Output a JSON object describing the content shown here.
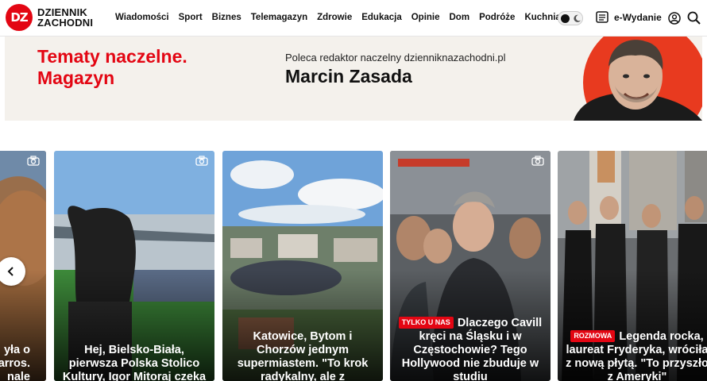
{
  "header": {
    "logo_badge": "DZ",
    "logo_line1": "DZIENNIK",
    "logo_line2": "ZACHODNI",
    "nav": [
      "Wiadomości",
      "Sport",
      "Biznes",
      "Telemagazyn",
      "Zdrowie",
      "Edukacja",
      "Opinie",
      "Dom",
      "Podróże",
      "Kuchnia"
    ],
    "ewydanie_label": "e-Wydanie",
    "icons": [
      "theme-toggle",
      "newspaper-icon",
      "user-icon",
      "search-icon"
    ]
  },
  "banner": {
    "title_line1": "Tematy naczelne.",
    "title_line2": "Magazyn",
    "kicker": "Poleca redaktor naczelny dzienniknazachodni.pl",
    "name": "Marcin Zasada"
  },
  "carousel": {
    "cards": [
      {
        "caption": "yła o\narros.\nnale",
        "badge": ""
      },
      {
        "caption": "Hej, Bielsko-Biała, pierwsza Polska Stolico Kultury, Igor Mitoraj czeka na twój gest!",
        "badge": ""
      },
      {
        "caption": "Katowice, Bytom i Chorzów jednym supermiastem. \"To krok radykalny, ale z potencjałem\"",
        "badge": ""
      },
      {
        "caption": "Dlaczego Cavill kręci na Śląsku i w Częstochowie? Tego Hollywood nie zbuduje w studiu",
        "badge": "TYLKO U NAS"
      },
      {
        "caption": "Legenda rocka, laureat Fryderyka, wróciła z nową płytą. \"To przyszło z Ameryki\"",
        "badge": "ROZMOWA"
      }
    ]
  },
  "colors": {
    "brand_red": "#e30613",
    "banner_bg": "#f4f1ec"
  }
}
